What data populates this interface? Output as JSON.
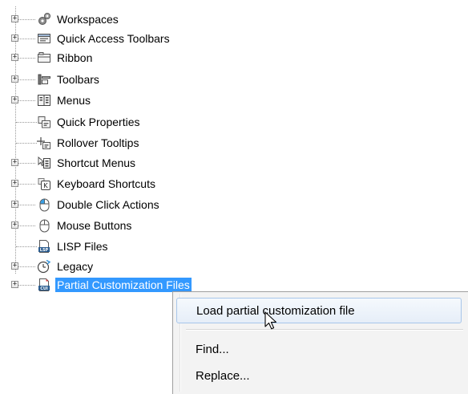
{
  "tree": {
    "items": [
      {
        "label": "Workspaces",
        "icon": "gears-icon",
        "expandable": true
      },
      {
        "label": "Quick Access Toolbars",
        "icon": "quick-access-toolbar-icon",
        "expandable": true
      },
      {
        "label": "Ribbon",
        "icon": "ribbon-icon",
        "expandable": true
      },
      {
        "label": "Toolbars",
        "icon": "toolbar-icon",
        "expandable": true
      },
      {
        "label": "Menus",
        "icon": "menu-icon",
        "expandable": true
      },
      {
        "label": "Quick Properties",
        "icon": "quick-properties-icon",
        "expandable": false
      },
      {
        "label": "Rollover Tooltips",
        "icon": "rollover-tooltip-icon",
        "expandable": false
      },
      {
        "label": "Shortcut Menus",
        "icon": "shortcut-menu-icon",
        "expandable": true
      },
      {
        "label": "Keyboard Shortcuts",
        "icon": "keyboard-icon",
        "expandable": true
      },
      {
        "label": "Double Click Actions",
        "icon": "mouse-double-click-icon",
        "expandable": true
      },
      {
        "label": "Mouse Buttons",
        "icon": "mouse-icon",
        "expandable": true
      },
      {
        "label": "LISP Files",
        "icon": "lisp-file-icon",
        "expandable": false
      },
      {
        "label": "Legacy",
        "icon": "clock-icon",
        "expandable": true
      },
      {
        "label": "Partial Customization Files",
        "icon": "cui-file-icon",
        "expandable": true,
        "selected": true
      }
    ],
    "expander_symbol": "+"
  },
  "context_menu": {
    "items": [
      {
        "label": "Load partial customization file",
        "highlighted": true
      },
      {
        "label": "Find..."
      },
      {
        "label": "Replace..."
      }
    ]
  },
  "colors": {
    "selection": "#3399ff",
    "menu_background": "#f3f3f3",
    "menu_hover_border": "#a8c6ea"
  }
}
